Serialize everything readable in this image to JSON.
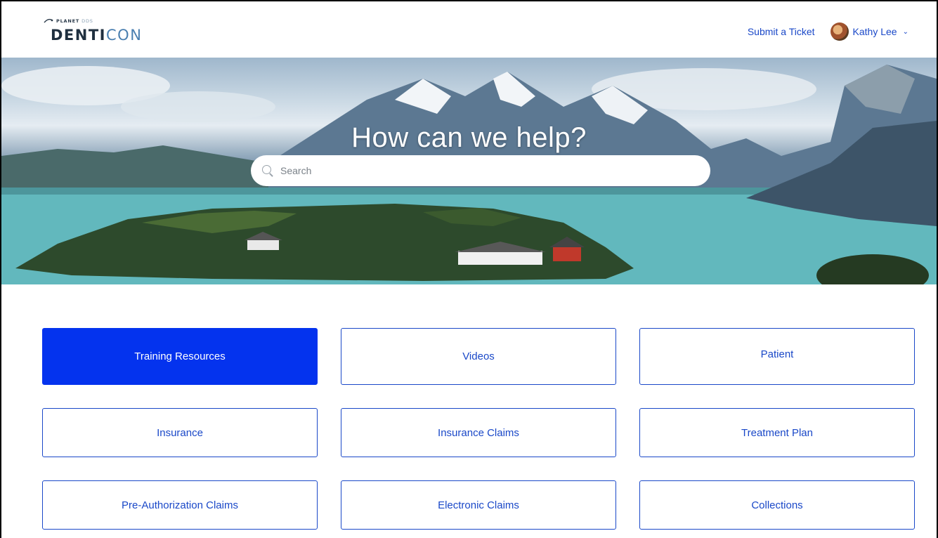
{
  "header": {
    "logo": {
      "brand_small": "PLANET",
      "brand_small_suffix": "DDS",
      "brand_main": "DENTI",
      "brand_main_accent": "CON"
    },
    "submit_ticket": "Submit a Ticket",
    "user_name": "Kathy Lee"
  },
  "hero": {
    "title": "How can we help?",
    "search_placeholder": "Search"
  },
  "tiles": [
    {
      "label": "Training Resources",
      "active": true
    },
    {
      "label": "Videos"
    },
    {
      "label": "Patient"
    },
    {
      "label": "Insurance"
    },
    {
      "label": "Insurance Claims"
    },
    {
      "label": "Treatment Plan"
    },
    {
      "label": "Pre-Authorization Claims"
    },
    {
      "label": "Electronic Claims"
    },
    {
      "label": "Collections"
    }
  ],
  "colors": {
    "link": "#1a48c8",
    "primary_tile": "#0433ee",
    "page_bg": "#ffffff"
  }
}
